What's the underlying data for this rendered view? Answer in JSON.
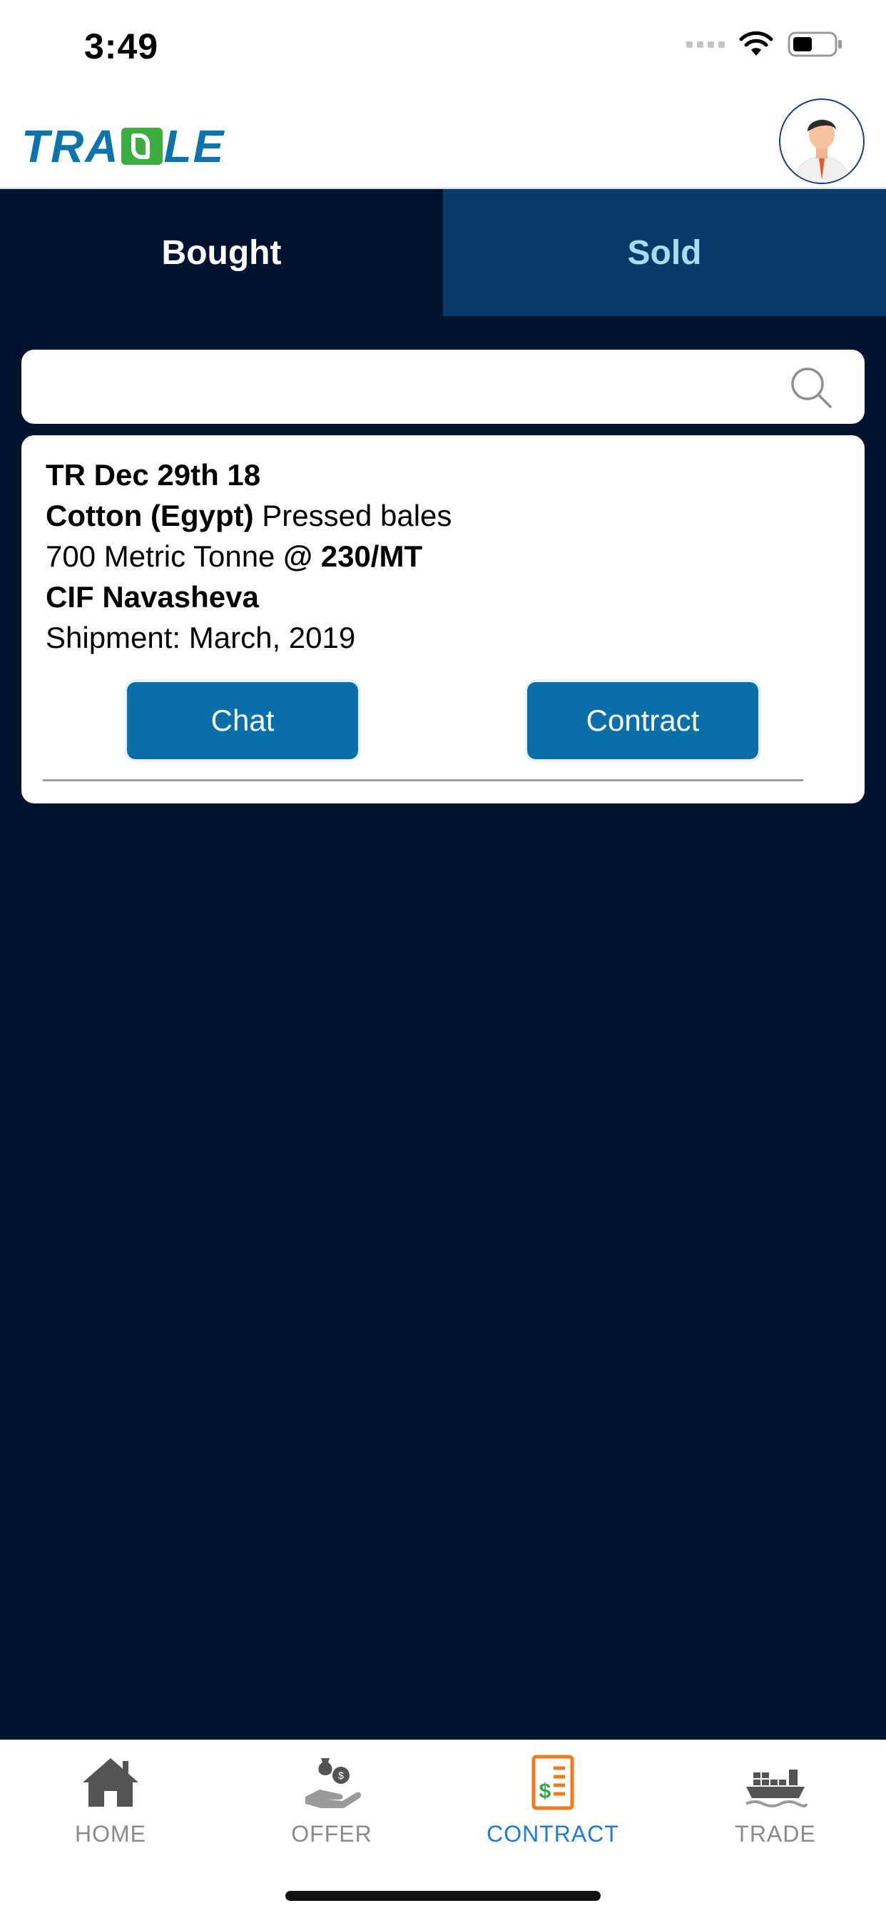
{
  "status_bar": {
    "time": "3:49"
  },
  "header": {
    "logo_text_left": "TRA",
    "logo_text_right": "LE"
  },
  "tabs": [
    {
      "label": "Bought",
      "active": true
    },
    {
      "label": "Sold",
      "active": false
    }
  ],
  "search": {
    "value": "",
    "placeholder": ""
  },
  "card": {
    "trade_ref": "TR Dec 29th 18",
    "commodity": "Cotton (Egypt)",
    "packing": "Pressed bales",
    "quantity": "700 Metric Tonne",
    "price": "@ 230/MT",
    "terms": "CIF Navasheva",
    "shipment_label": "Shipment:",
    "shipment_value": "March, 2019",
    "chat_label": "Chat",
    "contract_label": "Contract"
  },
  "bottom_nav": [
    {
      "label": "HOME",
      "icon": "home-icon",
      "active": false
    },
    {
      "label": "OFFER",
      "icon": "offer-icon",
      "active": false
    },
    {
      "label": "CONTRACT",
      "icon": "contract-icon",
      "active": true
    },
    {
      "label": "TRADE",
      "icon": "ship-icon",
      "active": false
    }
  ],
  "colors": {
    "background": "#01142f",
    "accent": "#0a6fa9",
    "active_nav": "#1f7ad9",
    "contract_icon": "#f07b1a",
    "inactive_nav": "#8a8a8a"
  }
}
